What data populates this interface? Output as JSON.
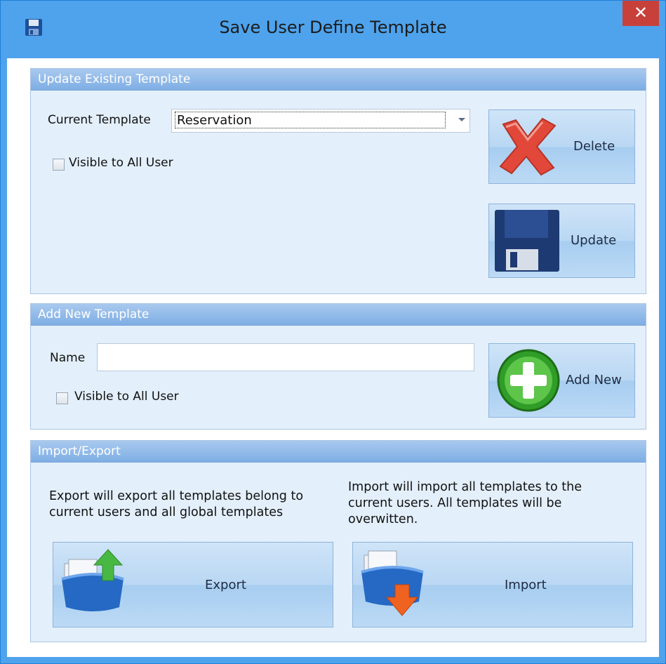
{
  "window": {
    "title": "Save User Define Template",
    "close_glyph": "✕"
  },
  "update_section": {
    "header": "Update Existing Template",
    "current_template_label": "Current Template",
    "current_template_value": "Reservation",
    "visible_label": "Visible to All User",
    "visible_checked": false,
    "delete_label": "Delete",
    "update_label": "Update"
  },
  "add_section": {
    "header": "Add New Template",
    "name_label": "Name",
    "name_value": "",
    "visible_label": "Visible to All User",
    "visible_checked": false,
    "add_label": "Add New"
  },
  "import_export": {
    "header": "Import/Export",
    "export_desc": "Export will export all templates belong to current users and all global templates",
    "import_desc": "Import will import all templates to the current users. All templates will be overwitten.",
    "export_label": "Export",
    "import_label": "Import"
  },
  "icons": {
    "app": "floppy-disk-icon",
    "delete": "red-x-icon",
    "update": "floppy-disk-icon",
    "add": "green-plus-icon",
    "export": "folder-upload-icon",
    "import": "folder-download-icon"
  },
  "colors": {
    "titlebar": "#4ea3ec",
    "close": "#c7413a",
    "group_header": "#8cb7e8",
    "button": "#bcdaf5"
  }
}
